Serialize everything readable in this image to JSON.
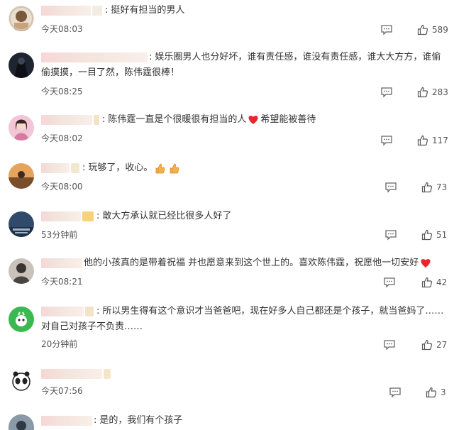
{
  "comments": [
    {
      "text": "挺好有担当的男人",
      "time": "今天08:03",
      "likes": "589"
    },
    {
      "text": "娱乐圈男人也分好坏，谁有责任感，谁没有责任感，谁大大方方，谁偷偷摸摸，一目了然，陈伟霆很棒！",
      "time": "今天08:25",
      "likes": "283"
    },
    {
      "text": "陈伟霆一直是个很暖很有担当的人",
      "text_after": "希望能被善待",
      "time": "今天08:02",
      "likes": "117"
    },
    {
      "text": "玩够了，收心。",
      "time": "今天08:00",
      "likes": "73"
    },
    {
      "text": "敢大方承认就已经比很多人好了",
      "time": "53分钟前",
      "likes": "51"
    },
    {
      "text": "他的小孩真的是带着祝福 并也愿意来到这个世上的。喜欢陈伟霆，祝愿他一切安好",
      "time": "今天08:21",
      "likes": "42"
    },
    {
      "text": "所以男生得有这个意识才当爸爸吧，现在好多人自己都还是个孩子，就当爸妈了……对自己对孩子不负责……",
      "time": "20分钟前",
      "likes": "27"
    },
    {
      "text": "",
      "time": "今天07:56",
      "likes": "3"
    },
    {
      "text": "是的，我们有个孩子",
      "time": "",
      "likes": ""
    }
  ],
  "icons": {
    "reply": "comment-bubble-icon",
    "like": "thumbs-up-icon",
    "heart": "red-heart-icon",
    "clap": "thumbs-emoji-icon"
  },
  "colors": {
    "heart": "#e8262d",
    "text": "#333333",
    "meta": "#555555"
  }
}
